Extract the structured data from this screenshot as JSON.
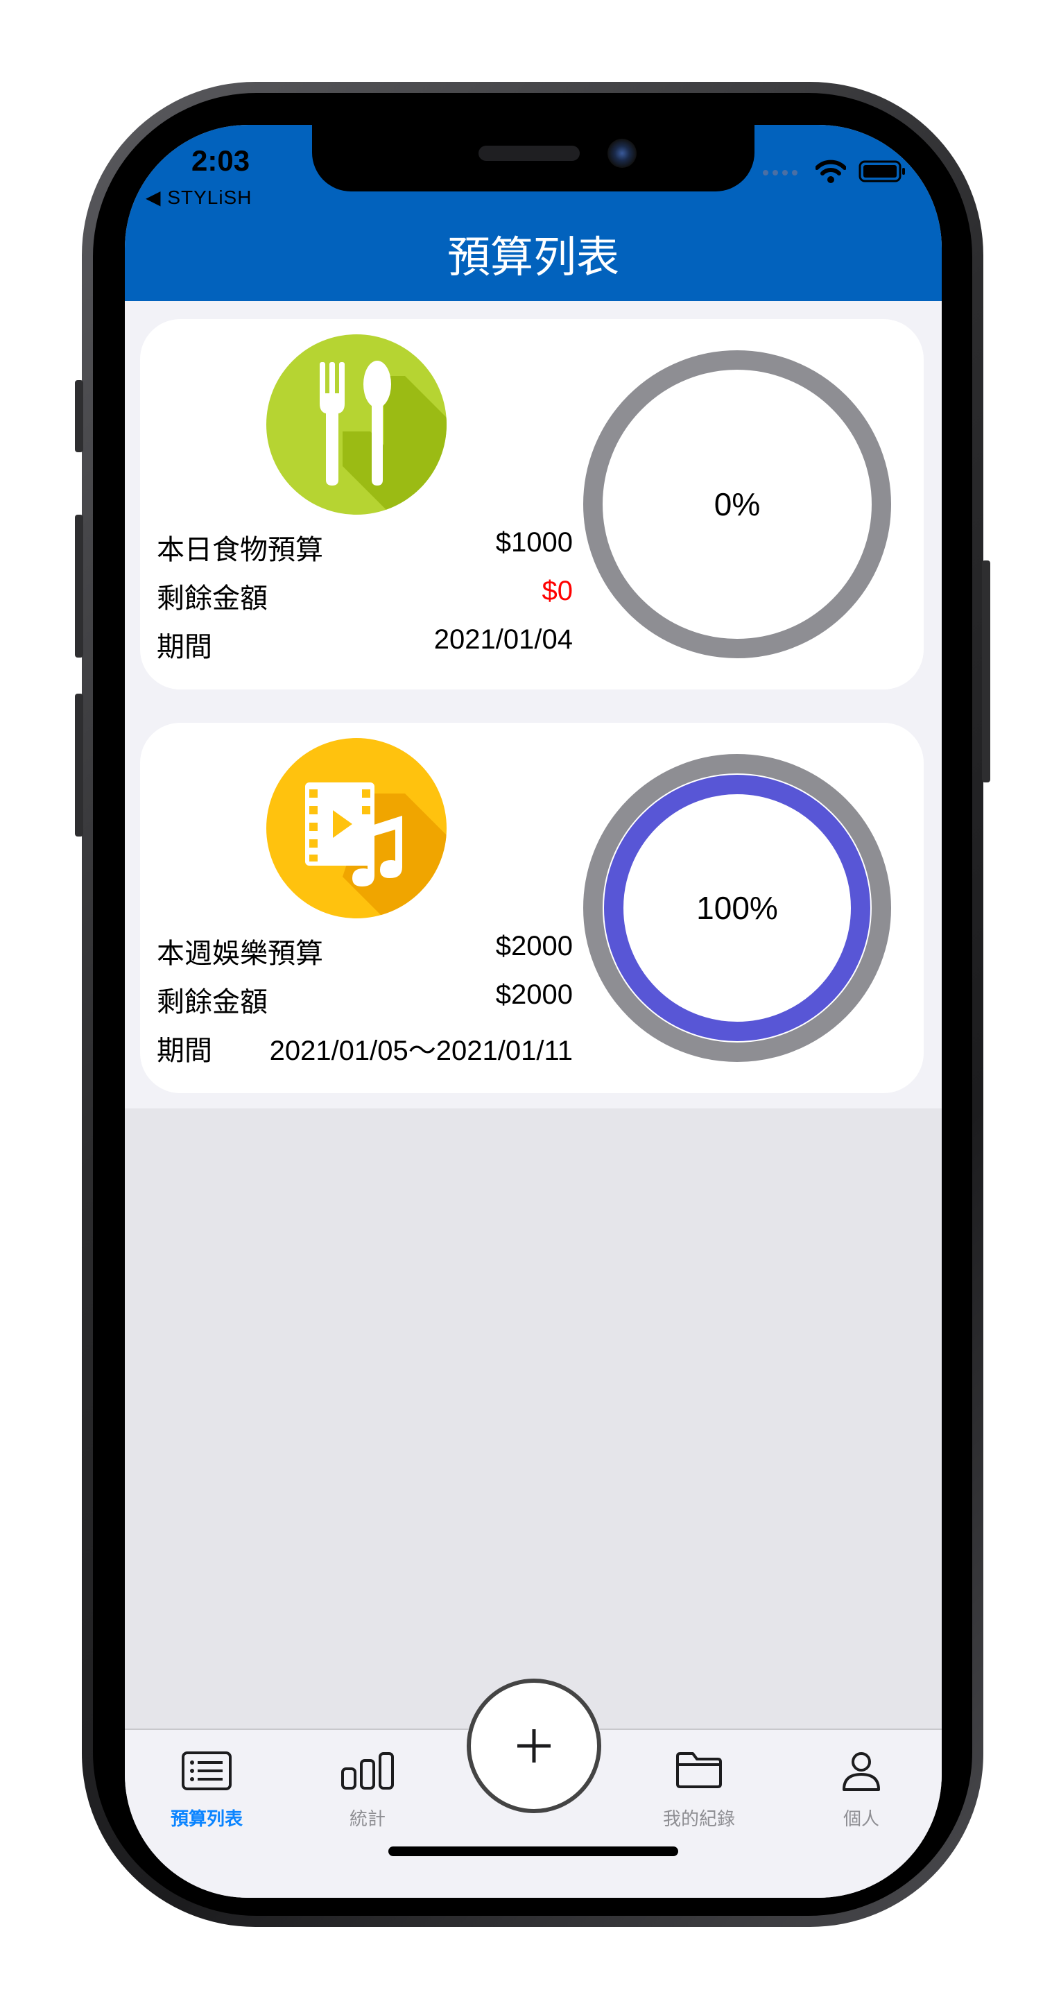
{
  "status": {
    "time": "2:03",
    "back_label": "◀ STYLiSH"
  },
  "nav": {
    "title": "預算列表"
  },
  "budgets": [
    {
      "icon": "fork-spoon-icon",
      "color": "#9ec21e",
      "name": "本日食物預算",
      "amount": "$1000",
      "remaining_label": "剩餘金額",
      "remaining": "$0",
      "remaining_color": "#ff0000",
      "period_label": "期間",
      "period": "2021/01/04",
      "percent_text": "0%",
      "progress": 0
    },
    {
      "icon": "film-music-icon",
      "color": "#ffc107",
      "name": "本週娛樂預算",
      "amount": "$2000",
      "remaining_label": "剩餘金額",
      "remaining": "$2000",
      "remaining_color": "#000000",
      "period_label": "期間",
      "period": "2021/01/05～2021/01/11",
      "percent_text": "100%",
      "progress": 100
    }
  ],
  "tabbar": {
    "items": [
      {
        "label": "預算列表",
        "icon": "list-icon",
        "active": true
      },
      {
        "label": "統計",
        "icon": "bar-chart-icon",
        "active": false
      },
      {
        "label": "我的紀錄",
        "icon": "folder-icon",
        "active": false
      },
      {
        "label": "個人",
        "icon": "person-icon",
        "active": false
      }
    ],
    "add_label": "+"
  },
  "colors": {
    "accent": "#0262bd",
    "ring_track": "#8e8e93",
    "ring_fill": "#5856d6",
    "tab_active": "#0a84ff"
  }
}
